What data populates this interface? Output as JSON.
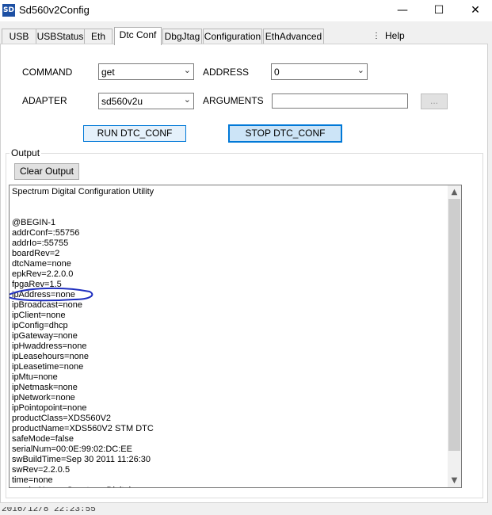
{
  "window": {
    "title": "Sd560v2Config",
    "icon_text": "SD",
    "minimize": "—",
    "maximize": "☐",
    "close": "✕"
  },
  "tabs": [
    {
      "label": "USB"
    },
    {
      "label": "USBStatus"
    },
    {
      "label": "Eth"
    },
    {
      "label": "Dtc Conf",
      "active": true
    },
    {
      "label": "DbgJtag"
    },
    {
      "label": "Configuration"
    },
    {
      "label": "EthAdvanced"
    }
  ],
  "menu": {
    "overflow": "⋮",
    "help": "Help"
  },
  "form": {
    "command_label": "COMMAND",
    "command_value": "get",
    "adapter_label": "ADAPTER",
    "adapter_value": "sd560v2u",
    "address_label": "ADDRESS",
    "address_value": "0",
    "arguments_label": "ARGUMENTS",
    "arguments_value": "",
    "browse_label": "...",
    "dropdown_icon": "⌄"
  },
  "buttons": {
    "run": "RUN DTC_CONF",
    "stop": "STOP DTC_CONF",
    "clear": "Clear Output"
  },
  "output": {
    "group_label": "Output",
    "lines": [
      "Spectrum Digital Configuration Utility",
      "",
      "",
      "@BEGIN-1",
      "addrConf=:55756",
      "addrIo=:55755",
      "boardRev=2",
      "dtcName=none",
      "epkRev=2.2.0.0",
      "fpgaRev=1.5",
      "ipAddress=none",
      "ipBroadcast=none",
      "ipClient=none",
      "ipConfig=dhcp",
      "ipGateway=none",
      "ipHwaddress=none",
      "ipLeasehours=none",
      "ipLeasetime=none",
      "ipMtu=none",
      "ipNetmask=none",
      "ipNetwork=none",
      "ipPointopoint=none",
      "productClass=XDS560V2",
      "productName=XDS560V2 STM DTC",
      "safeMode=false",
      "serialNum=00:0E:99:02:DC:EE",
      "swBuildTime=Sep 30 2011 11:26:30",
      "swRev=2.2.0.5",
      "time=none",
      "vendorName=Spectrum Digital"
    ],
    "annotation_color": "#1f2fbf"
  },
  "scrollbar": {
    "up": "▲",
    "down": "▼"
  },
  "status": {
    "text": "2016/12/8 22:23:55"
  }
}
